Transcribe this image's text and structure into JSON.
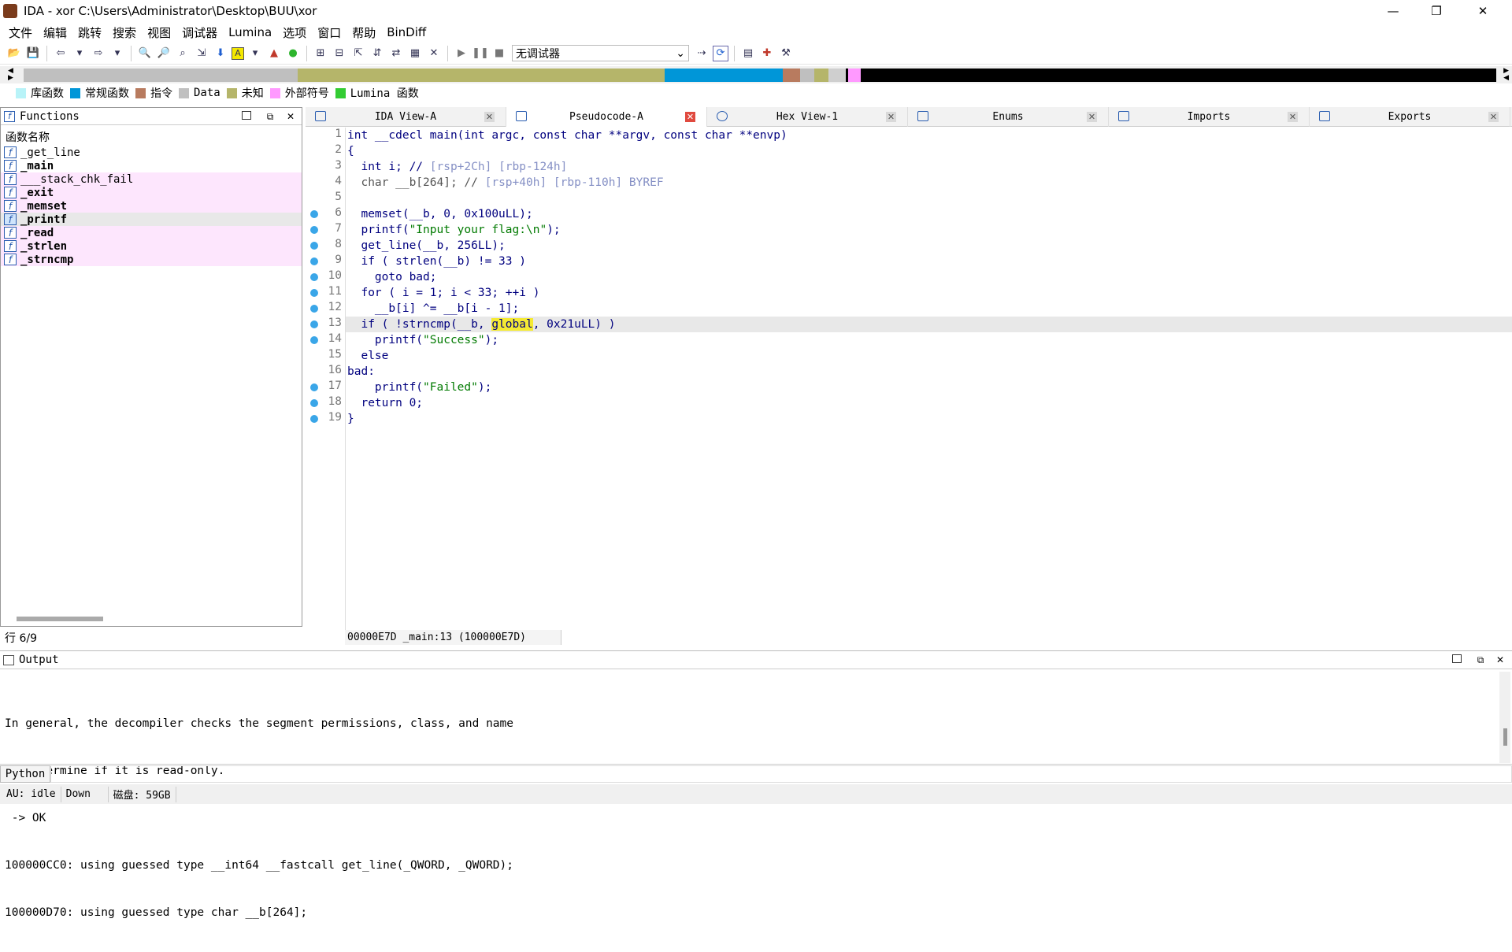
{
  "window": {
    "title": "IDA - xor C:\\Users\\Administrator\\Desktop\\BUU\\xor",
    "minimize": "—",
    "restore": "❐",
    "close": "✕"
  },
  "menu": [
    "文件",
    "编辑",
    "跳转",
    "搜索",
    "视图",
    "调试器",
    "Lumina",
    "选项",
    "窗口",
    "帮助",
    "BinDiff"
  ],
  "toolbar": {
    "debugger_select": "无调试器"
  },
  "legend": [
    {
      "label": "库函数",
      "color": "#b8f3f8"
    },
    {
      "label": "常规函数",
      "color": "#0096d8"
    },
    {
      "label": "指令",
      "color": "#b87b5f"
    },
    {
      "label": "Data",
      "color": "#c0c0c0"
    },
    {
      "label": "未知",
      "color": "#b5b56a"
    },
    {
      "label": "外部符号",
      "color": "#ff99ff"
    },
    {
      "label": "Lumina 函数",
      "color": "#33cc33"
    }
  ],
  "functions": {
    "title": "Functions",
    "column": "函数名称",
    "items": [
      "_get_line",
      "_main",
      "___stack_chk_fail",
      "_exit",
      "_memset",
      "_printf",
      "_read",
      "_strlen",
      "_strncmp"
    ],
    "row_status": "行 6/9"
  },
  "tabs": [
    "IDA View-A",
    "Pseudocode-A",
    "Hex View-1",
    "Enums",
    "Imports",
    "Exports"
  ],
  "code": {
    "line_numbers": [
      "1",
      "2",
      "3",
      "4",
      "5",
      "6",
      "7",
      "8",
      "9",
      "10",
      "11",
      "12",
      "13",
      "14",
      "15",
      "16",
      "17",
      "18",
      "19"
    ],
    "l1": "int __cdecl main(int argc, const char **argv, const char **envp)",
    "l2": "{",
    "l3a": "  int i; // ",
    "l3b": "[rsp+2Ch] [rbp-124h]",
    "l4a": "  char __b[264]; // ",
    "l4b": "[rsp+40h] [rbp-110h] BYREF",
    "l5": "",
    "l6": "  memset(__b, 0, 0x100uLL);",
    "l7a": "  printf(",
    "l7b": "\"Input your flag:\\n\"",
    "l7c": ");",
    "l8": "  get_line(__b, 256LL);",
    "l9": "  if ( strlen(__b) != 33 )",
    "l10": "    goto bad;",
    "l11": "  for ( i = 1; i < 33; ++i )",
    "l12": "    __b[i] ^= __b[i - 1];",
    "l13a": "  if ( !strncmp(__b, ",
    "l13b": "global",
    "l13c": ", 0x21uLL) )",
    "l14a": "    printf(",
    "l14b": "\"Success\"",
    "l14c": ");",
    "l15": "  else",
    "l16": "bad:",
    "l17a": "    printf(",
    "l17b": "\"Failed\"",
    "l17c": ");",
    "l18": "  return 0;",
    "l19": "}",
    "status": "00000E7D _main:13 (100000E7D)"
  },
  "output": {
    "title": "Output",
    "lines": [
      "In general, the decompiler checks the segment permissions, class, and name",
      "to determine if it is read-only.",
      " -> OK",
      "100000CC0: using guessed type __int64 __fastcall get_line(_QWORD, _QWORD);",
      "100000D70: using guessed type char __b[264];"
    ]
  },
  "python_button": "Python",
  "statusbar": {
    "au": "AU:  idle",
    "dir": "Down",
    "disk": "磁盘: 59GB"
  }
}
